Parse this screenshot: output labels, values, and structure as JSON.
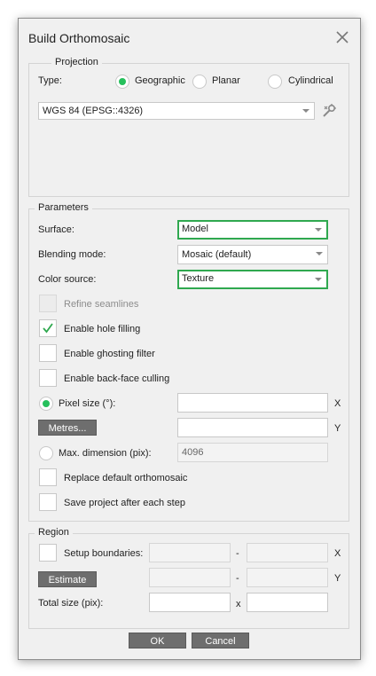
{
  "dialog": {
    "title": "Build Orthomosaic"
  },
  "projection": {
    "legend": "Projection",
    "type_label": "Type:",
    "options": [
      "Geographic",
      "Planar",
      "Cylindrical"
    ],
    "selected": "Geographic",
    "crs_value": "WGS 84 (EPSG::4326)"
  },
  "parameters": {
    "legend": "Parameters",
    "surface_label": "Surface:",
    "surface_value": "Model",
    "blending_label": "Blending mode:",
    "blending_value": "Mosaic (default)",
    "color_source_label": "Color source:",
    "color_source_value": "Texture",
    "refine_seamlines": {
      "label": "Refine seamlines",
      "checked": false,
      "enabled": false
    },
    "enable_hole_filling": {
      "label": "Enable hole filling",
      "checked": true
    },
    "enable_ghosting_filter": {
      "label": "Enable ghosting filter",
      "checked": false
    },
    "enable_backface_culling": {
      "label": "Enable back-face culling",
      "checked": false
    },
    "pixel_size_label": "Pixel size (°):",
    "pixel_x_value": "",
    "pixel_y_value": "",
    "x_suffix": "X",
    "y_suffix": "Y",
    "metres_button": "Metres...",
    "max_dimension_label": "Max. dimension (pix):",
    "max_dimension_value": "4096",
    "replace_default": {
      "label": "Replace default orthomosaic",
      "checked": false
    },
    "save_project": {
      "label": "Save project after each step",
      "checked": false
    }
  },
  "region": {
    "legend": "Region",
    "setup_boundaries_label": "Setup boundaries:",
    "estimate_button": "Estimate",
    "total_size_label": "Total size (pix):",
    "dash": "-",
    "x_suffix": "X",
    "y_suffix": "Y",
    "times": "x"
  },
  "footer": {
    "ok": "OK",
    "cancel": "Cancel"
  },
  "colors": {
    "highlight": "#2fa84f",
    "radio_on": "#26c05c",
    "button_bg": "#6e6e6e"
  }
}
